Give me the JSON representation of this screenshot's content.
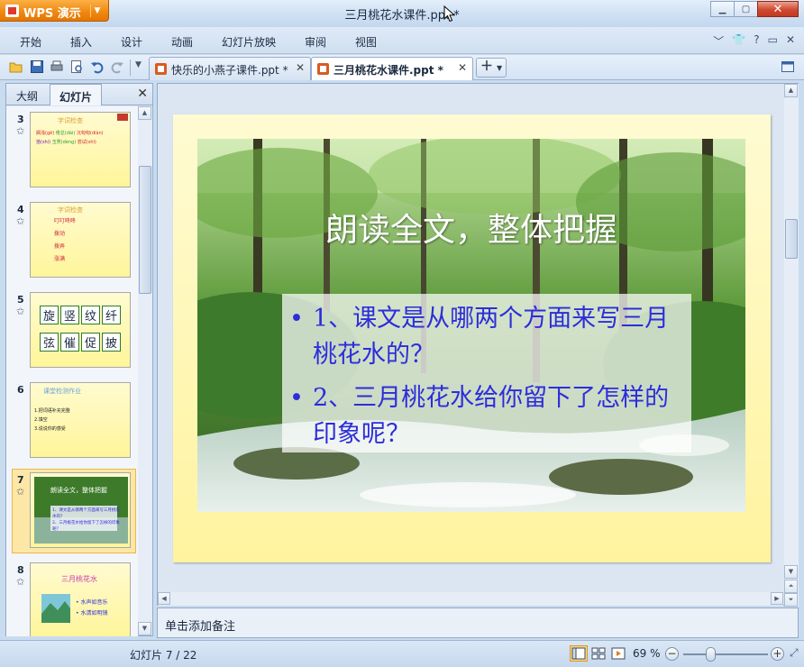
{
  "app": {
    "name": "WPS 演示",
    "window_title": "三月桃花水课件.ppt *"
  },
  "menu": [
    "开始",
    "插入",
    "设计",
    "动画",
    "幻灯片放映",
    "审阅",
    "视图"
  ],
  "tabs": [
    {
      "label": "快乐的小燕子课件.ppt *",
      "active": false
    },
    {
      "label": "三月桃花水课件.ppt *",
      "active": true
    }
  ],
  "side_panel": {
    "tabs": [
      "大纲",
      "幻灯片"
    ],
    "active_tab": "幻灯片",
    "thumbnails": [
      {
        "number": "3",
        "title": "字词检查",
        "lines": [
          "搁浅(gē)",
          "倦怠(dài)",
          "沉甸甸(diàn)",
          "拾(shí)",
          "玉凳(dèng)",
          "尝试(shì)"
        ]
      },
      {
        "number": "4",
        "title": "字词检查",
        "lines": [
          "叮叮咚咚",
          "拨动",
          "拨弄",
          "涨满"
        ]
      },
      {
        "number": "5",
        "rows": [
          [
            "旋",
            "竖",
            "纹",
            "纤"
          ],
          [
            "弦",
            "催",
            "促",
            "披"
          ]
        ]
      },
      {
        "number": "6",
        "title": "课堂检测作业",
        "lines": [
          "1.把词语补充完整",
          "2.填空",
          "3.说说你的感受"
        ]
      },
      {
        "number": "7",
        "title": "朗读全文，整体把握",
        "lines": [
          "1、课文是从哪两个方面来写三月桃花水的？",
          "2、三月桃花水给你留下了怎样的印象呢？"
        ]
      },
      {
        "number": "8",
        "title": "三月桃花水",
        "lines": [
          "• 水声如音乐",
          "• 水清如明镜"
        ]
      }
    ],
    "selected": "7"
  },
  "slide": {
    "title": "朗读全文，整体把握",
    "bullets": [
      "1、课文是从哪两个方面来写三月桃花水的？",
      "2、三月桃花水给你留下了怎样的印象呢？"
    ]
  },
  "notes_placeholder": "单击添加备注",
  "status": {
    "slide_counter": "幻灯片 7 / 22",
    "zoom": "69 %"
  },
  "colors": {
    "accent": "#f08a12",
    "bullet_text": "#2d2ddb",
    "slide_bg": "#fff6b0"
  }
}
